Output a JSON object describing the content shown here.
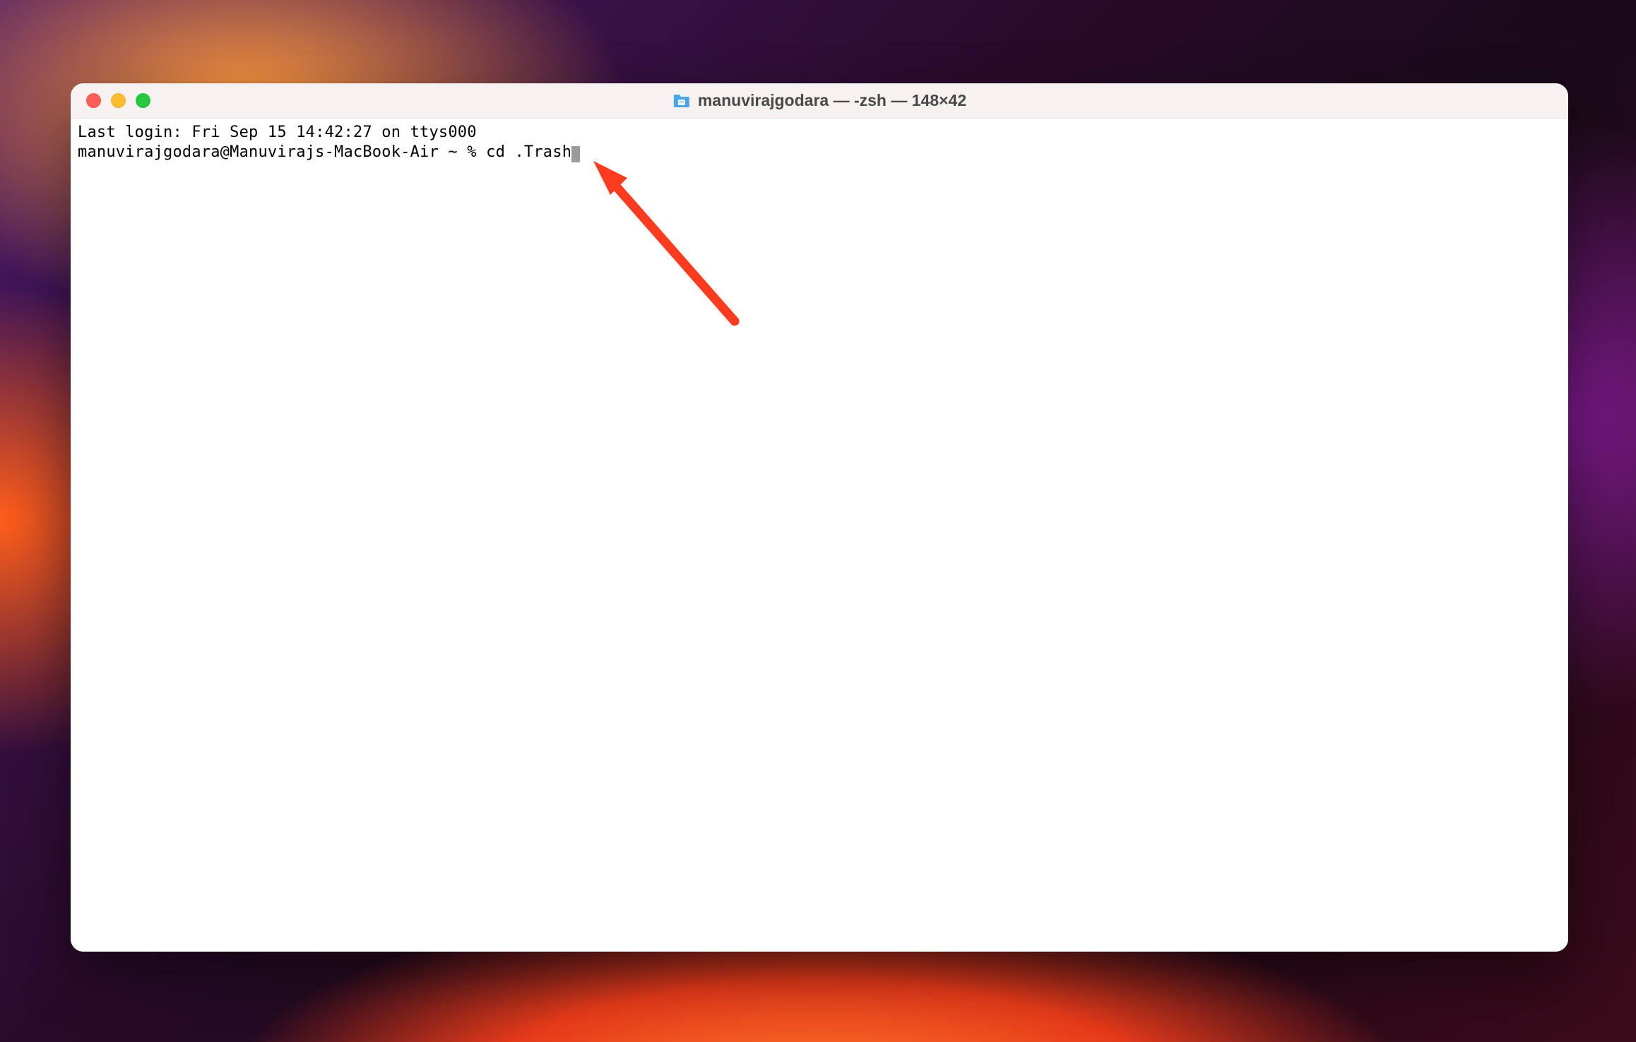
{
  "window": {
    "title": "manuvirajgodara — -zsh — 148×42"
  },
  "terminal": {
    "last_login_line": "Last login: Fri Sep 15 14:42:27 on ttys000",
    "prompt": "manuvirajgodara@Manuvirajs-MacBook-Air ~ % ",
    "command": "cd .Trash"
  },
  "icons": {
    "folder": "folder-icon",
    "close": "close-icon",
    "minimize": "minimize-icon",
    "maximize": "maximize-icon"
  },
  "annotation": {
    "type": "arrow",
    "color": "#ff3b1f"
  }
}
